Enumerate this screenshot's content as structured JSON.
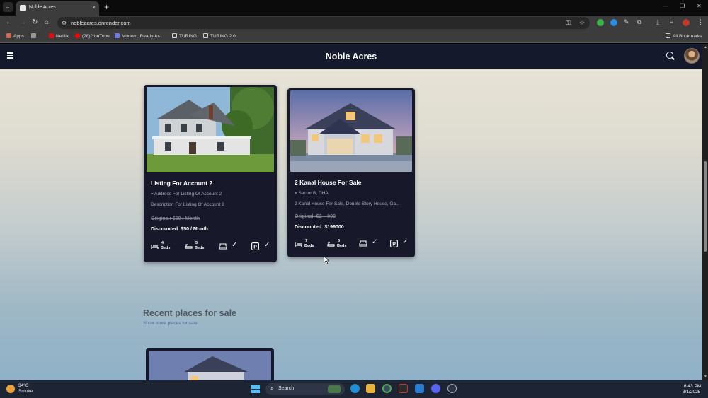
{
  "browser": {
    "tab_title": "Noble Acres",
    "tab_close": "×",
    "new_tab": "+",
    "url": "nobleacres.onrender.com",
    "window_controls": [
      "—",
      "❐",
      "✕"
    ],
    "bookmarks": [
      "Apps",
      "Netflix",
      "(28) YouTube",
      "Modern, Ready-to-...",
      "TURING",
      "TURING 2.0"
    ],
    "all_bookmarks": "All Bookmarks"
  },
  "app": {
    "brand": "Noble Acres"
  },
  "listings": [
    {
      "title": "Listing For Account 2",
      "address": "Address For Listing Of Account 2",
      "description": "Description For Listing Of Account 2",
      "original": "Original: $60 / Month",
      "discounted": "Discounted: $50 / Month",
      "beds": "4",
      "baths": "5",
      "beds_label": "Beds",
      "baths_label": "Beds"
    },
    {
      "title": "2 Kanal House For Sale",
      "address": "Sector B, DHA",
      "description": "2 Kanal House For Sale, Double Story House, Ga...",
      "original": "Original: $2__000",
      "discounted": "Discounted: $199000",
      "beds": "7",
      "baths": "6",
      "beds_label": "Beds",
      "baths_label": "Beds"
    }
  ],
  "recent": {
    "title": "Recent places for sale",
    "link": "Show more places for sale"
  },
  "taskbar": {
    "temperature": "34°C",
    "condition": "Smoke",
    "search": "Search",
    "time": "6:43 PM",
    "date": "8/1/2025"
  },
  "colors": {
    "appbar": "#141a2b",
    "card": "#17192a",
    "link": "#4b6b9b"
  }
}
